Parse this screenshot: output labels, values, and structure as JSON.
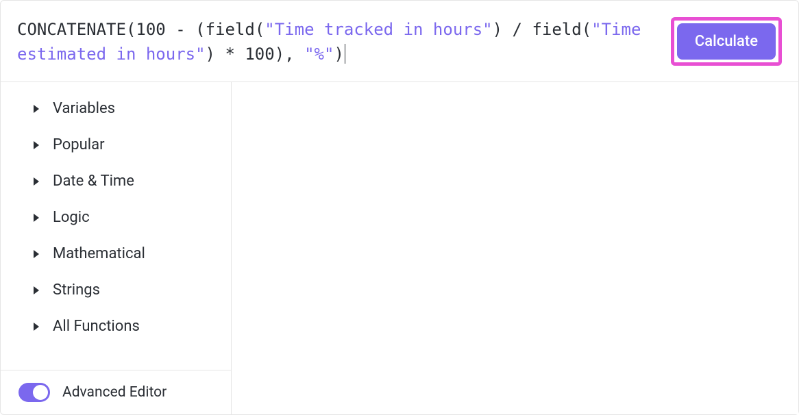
{
  "formula": {
    "tokens": [
      {
        "t": "fn",
        "v": "CONCATENATE"
      },
      {
        "t": "paren",
        "v": "("
      },
      {
        "t": "num",
        "v": "100"
      },
      {
        "t": "op",
        "v": " - "
      },
      {
        "t": "paren",
        "v": "("
      },
      {
        "t": "fn",
        "v": "field"
      },
      {
        "t": "paren",
        "v": "("
      },
      {
        "t": "str",
        "v": "\"Time tracked in hours\""
      },
      {
        "t": "paren",
        "v": ")"
      },
      {
        "t": "op",
        "v": " / "
      },
      {
        "t": "fn",
        "v": "field"
      },
      {
        "t": "paren",
        "v": "("
      },
      {
        "t": "str",
        "v": "\"Time estimated in hours\""
      },
      {
        "t": "paren",
        "v": ")"
      },
      {
        "t": "op",
        "v": " * "
      },
      {
        "t": "num",
        "v": "100"
      },
      {
        "t": "paren",
        "v": ")"
      },
      {
        "t": "op",
        "v": ", "
      },
      {
        "t": "str",
        "v": "\"%\""
      },
      {
        "t": "paren",
        "v": ")"
      }
    ]
  },
  "calculate_label": "Calculate",
  "sidebar": {
    "categories": [
      {
        "label": "Variables"
      },
      {
        "label": "Popular"
      },
      {
        "label": "Date & Time"
      },
      {
        "label": "Logic"
      },
      {
        "label": "Mathematical"
      },
      {
        "label": "Strings"
      },
      {
        "label": "All Functions"
      }
    ],
    "advanced_editor_label": "Advanced Editor",
    "advanced_editor_on": true
  },
  "highlight": {
    "target": "calculate-button",
    "color": "#e84fd3"
  }
}
